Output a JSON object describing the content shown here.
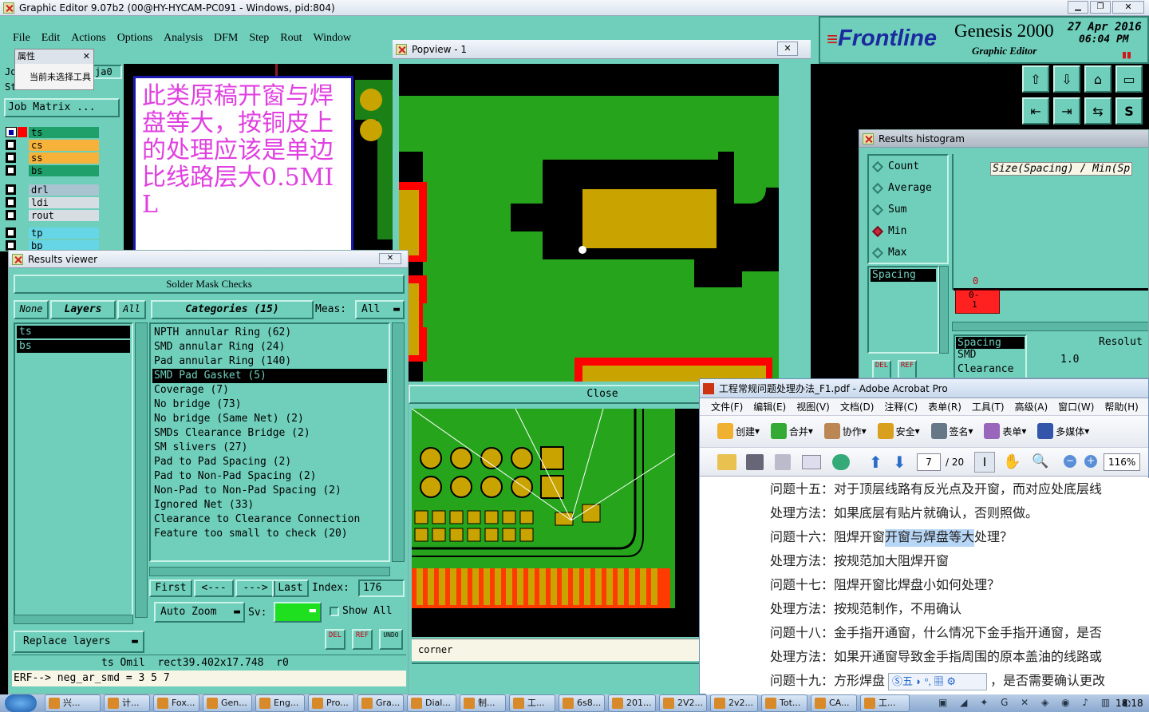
{
  "main_window": {
    "title": "Graphic Editor 9.07b2 (00@HY-HYCAM-PC091 - Windows, pid:804)",
    "menu": [
      "File",
      "Edit",
      "Actions",
      "Options",
      "Analysis",
      "DFM",
      "Step",
      "Rout",
      "Window"
    ],
    "job_label_a": "Jo",
    "job_label_b": "St",
    "job_value": "ja0",
    "job_matrix_button": "Job Matrix ...",
    "layers": [
      {
        "name": "ts",
        "color": "#1f9f6a"
      },
      {
        "name": "cs",
        "color": "#f7b23a"
      },
      {
        "name": "ss",
        "color": "#f7b23a"
      },
      {
        "name": "bs",
        "color": "#1f9f6a"
      },
      {
        "name": "drl",
        "color": "#a9c3d0"
      },
      {
        "name": "ldi",
        "color": "#d6dde3"
      },
      {
        "name": "rout",
        "color": "#d6dde3"
      },
      {
        "name": "tp",
        "color": "#66d6e6"
      },
      {
        "name": "bp",
        "color": "#66d6e6"
      }
    ]
  },
  "tooltip_popup": {
    "title": "属性",
    "item": "当前未选择工具"
  },
  "note_box": {
    "text": "此类原稿开窗与焊盘等大，按铜皮上的处理应该是单边比线路层大0.5MIL"
  },
  "brand": {
    "logo": "Frontline",
    "product": "Genesis 2000",
    "subtitle": "Graphic Editor",
    "date": "27 Apr 2016",
    "time": "06:04 PM"
  },
  "popview": {
    "title": "Popview - 1",
    "close_label": "Close",
    "corner_label": "corner"
  },
  "results_viewer": {
    "title": "Results viewer",
    "header": "Solder Mask Checks",
    "btn_none": "None",
    "btn_layers": "Layers",
    "btn_all": "All",
    "categories_label": "Categories (15)",
    "meas_label": "Meas:",
    "meas_value": "All",
    "layer_list": [
      "ts",
      "bs"
    ],
    "categories": [
      "NPTH annular Ring (62)",
      "SMD annular Ring (24)",
      "Pad annular Ring (140)",
      "SMD Pad Gasket (5)",
      "Coverage (7)",
      "No bridge (73)",
      "No bridge (Same Net) (2)",
      "SMDs Clearance Bridge (2)",
      "SM slivers (27)",
      "Pad to Pad Spacing (2)",
      "Pad to Non-Pad Spacing (2)",
      "Non-Pad to Non-Pad Spacing (2)",
      "Ignored Net (33)",
      "Clearance to Clearance Connection",
      "Feature too small to check (20)"
    ],
    "selected_index": 3,
    "nav_first": "First",
    "nav_prev": "<---",
    "nav_next": "--->",
    "nav_last": "Last",
    "index_label": "Index:",
    "index_value": "176",
    "auto_zoom": "Auto Zoom",
    "sv_label": "Sv:",
    "show_all": "Show All",
    "replace_layers": "Replace layers",
    "del": "DEL",
    "ref": "REF",
    "undo": "UNDO",
    "status_line": "ts Omil  rect39.402x17.748  r0",
    "erf_line": "ERF--> neg_ar_smd = 3 5 7"
  },
  "histogram": {
    "title": "Results histogram",
    "options": [
      "Count",
      "Average",
      "Sum",
      "Min",
      "Max"
    ],
    "selected_option": "Min",
    "axis_title": "Size(Spacing) / Min(Sp",
    "list_item": "Spacing",
    "bar_top_label": "0",
    "bar_label_a": "0-",
    "bar_label_b": "1",
    "list2": [
      "Spacing",
      "SMD",
      "Clearance"
    ],
    "resolution_label": "Resolut",
    "resolution_value": "1.0",
    "del": "DEL",
    "ref": "REF"
  },
  "acrobat": {
    "title": "工程常规问题处理办法_F1.pdf - Adobe Acrobat Pro",
    "menu": [
      "文件(F)",
      "编辑(E)",
      "视图(V)",
      "文档(D)",
      "注释(C)",
      "表单(R)",
      "工具(T)",
      "高级(A)",
      "窗口(W)",
      "帮助(H)"
    ],
    "toolbar": [
      "创建",
      "合并",
      "协作",
      "安全",
      "签名",
      "表单",
      "多媒体"
    ],
    "page_current": "7",
    "page_total": "/ 20",
    "zoom": "116%",
    "lines": [
      "问题十五：对于顶层线路有反光点及开窗，而对应处底层线",
      "处理方法：如果底层有贴片就确认，否则照做。",
      "问题十六：阻焊开窗与焊盘等大如何处理？",
      "处理方法：按规范加大阻焊开窗",
      "问题十七：阻焊开窗比焊盘小如何处理？",
      "处理方法：按规范制作，不用确认",
      "问题十八：金手指开通窗，什么情况下金手指开通窗，是否",
      "处理方法：如果开通窗导致金手指周围的原本盖油的线路或",
      "问题十九：方形焊盘",
      "，是否需要确认更改"
    ],
    "highlight": "开窗与焊盘等大",
    "ime_text": "五"
  },
  "taskbar": {
    "items": [
      "兴...",
      "计...",
      "Fox...",
      "Gen...",
      "Eng...",
      "Pro...",
      "Gra...",
      "Dial...",
      "制...",
      "工...",
      "6s8...",
      "201...",
      "2V2...",
      "2v2...",
      "Tot...",
      "CA...",
      "工..."
    ],
    "clock": "18:18"
  },
  "colors": {
    "teal": "#6fcfbb",
    "pcb_green": "#26a51c",
    "pad_gold": "#c9a400",
    "mask_red": "#ff0000"
  }
}
